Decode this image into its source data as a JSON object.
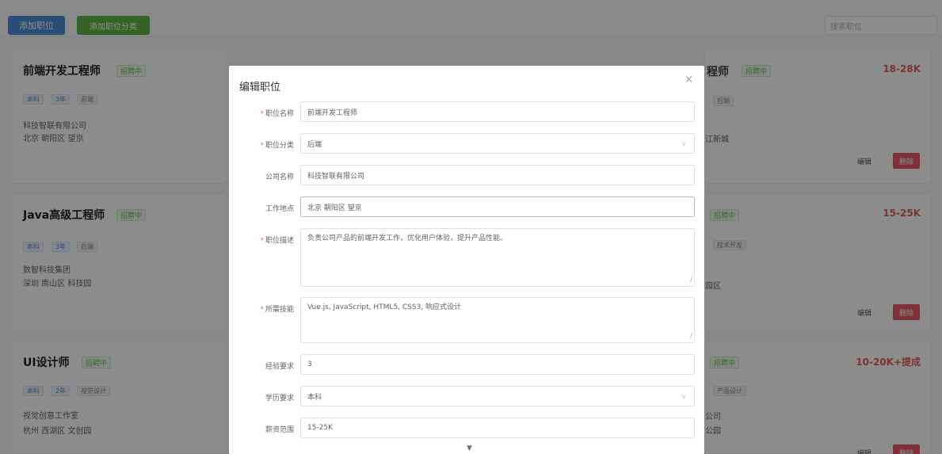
{
  "toolbar": {
    "add_job": "添加职位",
    "add_category": "添加职位分类",
    "search_placeholder": "搜索职位"
  },
  "cards_left": [
    {
      "title": "前端开发工程师",
      "status": "招聘中",
      "tags": [
        "本科",
        "3年",
        "前端"
      ],
      "company": "科技智联有限公司",
      "location": "北京 朝阳区 望京"
    },
    {
      "title": "Java高级工程师",
      "status": "招聘中",
      "tags": [
        "本科",
        "3年",
        "后端"
      ],
      "company": "数智科技集团",
      "location": "深圳 南山区 科技园"
    },
    {
      "title": "UI设计师",
      "status": "招聘中",
      "tags": [
        "本科",
        "2年",
        "视觉设计"
      ],
      "company": "视觉创意工作室",
      "location": "杭州 西湖区 文创园"
    }
  ],
  "cards_right": [
    {
      "title_fragment": "程师",
      "status": "招聘中",
      "salary": "18-28K",
      "tag": "后端",
      "location_fragment": "江新城",
      "edit": "编辑",
      "delete": "删除"
    },
    {
      "status": "招聘中",
      "salary": "15-25K",
      "tag": "技术开发",
      "location_fragment": "园区",
      "edit": "编辑",
      "delete": "删除"
    },
    {
      "status": "招聘中",
      "salary": "10-20K+提成",
      "tag": "产品设计",
      "company_fragment": "公司",
      "location_fragment": "公园",
      "edit": "编辑",
      "delete": "删除"
    }
  ],
  "modal": {
    "title": "编辑职位",
    "close": "×",
    "fields": {
      "job_name": {
        "label": "职位名称",
        "value": "前端开发工程师",
        "required": true
      },
      "job_category": {
        "label": "职位分类",
        "value": "后端",
        "required": true
      },
      "company": {
        "label": "公司名称",
        "value": "科技智联有限公司",
        "required": false
      },
      "location": {
        "label": "工作地点",
        "value": "北京 朝阳区 望京",
        "required": false
      },
      "description": {
        "label": "职位描述",
        "value": "负责公司产品的前端开发工作，优化用户体验，提升产品性能。",
        "required": true
      },
      "skills": {
        "label": "所需技能",
        "value": "Vue.js, JavaScript, HTML5, CSS3, 响应式设计",
        "required": true
      },
      "experience": {
        "label": "经验要求",
        "value": "3",
        "required": false
      },
      "education": {
        "label": "学历要求",
        "value": "本科",
        "required": false
      },
      "salary": {
        "label": "薪资范围",
        "value": "15-25K",
        "required": false
      }
    },
    "required_mark": "*",
    "scroll_indicator": "▼"
  }
}
